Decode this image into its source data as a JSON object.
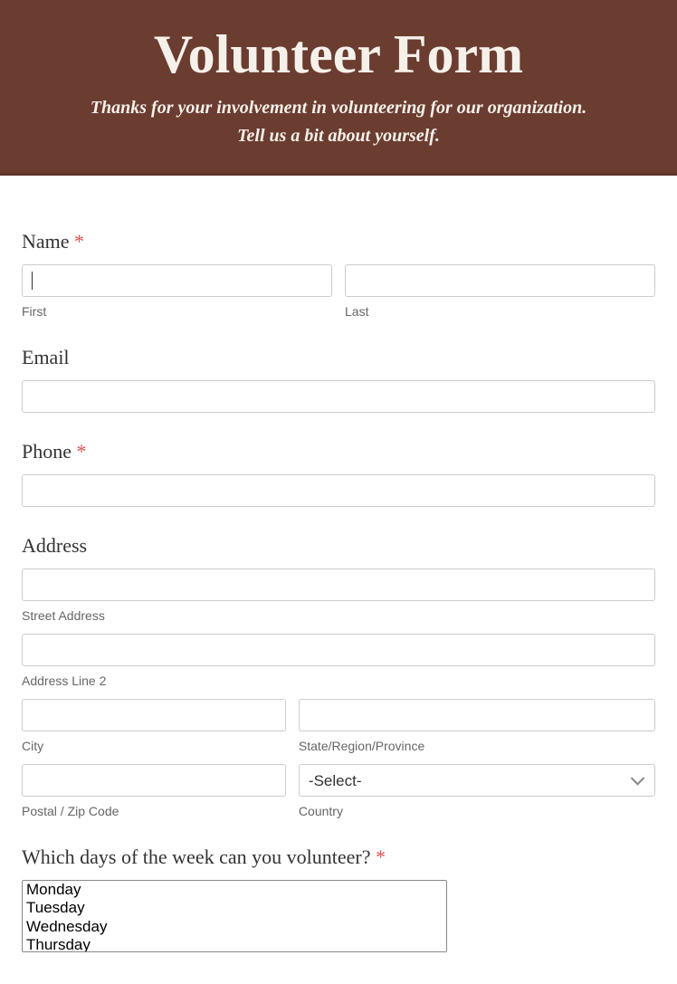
{
  "header": {
    "title": "Volunteer Form",
    "subtitle_line1": "Thanks for your involvement in volunteering for our organization.",
    "subtitle_line2": "Tell us a bit about yourself."
  },
  "fields": {
    "name": {
      "label": "Name",
      "required": "*",
      "first_value": "",
      "first_sublabel": "First",
      "last_value": "",
      "last_sublabel": "Last"
    },
    "email": {
      "label": "Email",
      "value": ""
    },
    "phone": {
      "label": "Phone",
      "required": "*",
      "value": ""
    },
    "address": {
      "label": "Address",
      "street_value": "",
      "street_sublabel": "Street Address",
      "line2_value": "",
      "line2_sublabel": "Address Line 2",
      "city_value": "",
      "city_sublabel": "City",
      "state_value": "",
      "state_sublabel": "State/Region/Province",
      "postal_value": "",
      "postal_sublabel": "Postal / Zip Code",
      "country_selected": "-Select-",
      "country_sublabel": "Country"
    },
    "days": {
      "label": "Which days of the week can you volunteer?",
      "required": "*",
      "options": [
        "Monday",
        "Tuesday",
        "Wednesday",
        "Thursday"
      ]
    }
  }
}
